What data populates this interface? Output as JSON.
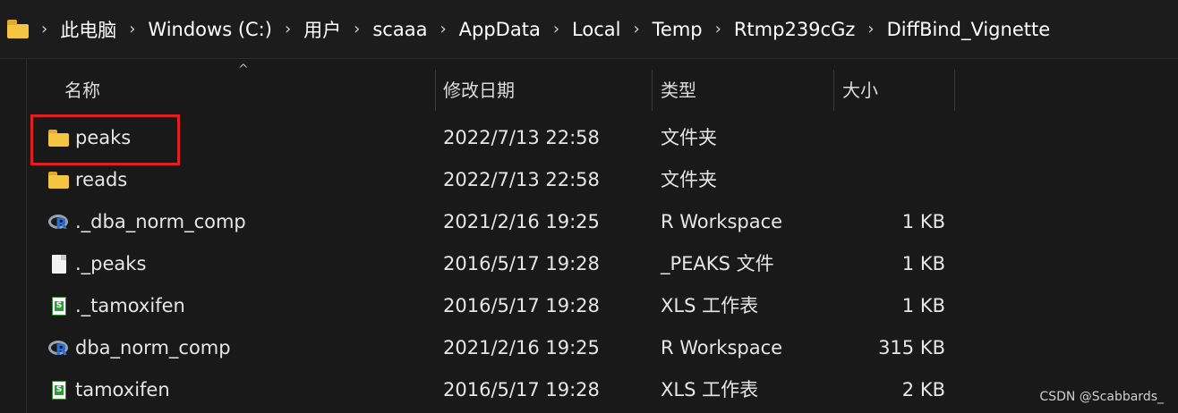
{
  "address_bar": {
    "crumbs": [
      "此电脑",
      "Windows (C:)",
      "用户",
      "scaaa",
      "AppData",
      "Local",
      "Temp",
      "Rtmp239cGz",
      "DiffBind_Vignette"
    ],
    "separator": "›"
  },
  "columns": {
    "name": "名称",
    "date": "修改日期",
    "type": "类型",
    "size": "大小",
    "sort_indicator": "^"
  },
  "files": [
    {
      "name": "peaks",
      "date": "2022/7/13 22:58",
      "type": "文件夹",
      "size": "",
      "icon": "folder-icon"
    },
    {
      "name": "reads",
      "date": "2022/7/13 22:58",
      "type": "文件夹",
      "size": "",
      "icon": "folder-icon"
    },
    {
      "name": "._dba_norm_comp",
      "date": "2021/2/16 19:25",
      "type": "R Workspace",
      "size": "1 KB",
      "icon": "r-workspace-icon"
    },
    {
      "name": "._peaks",
      "date": "2016/5/17 19:28",
      "type": "_PEAKS 文件",
      "size": "1 KB",
      "icon": "file-icon"
    },
    {
      "name": "._tamoxifen",
      "date": "2016/5/17 19:28",
      "type": "XLS 工作表",
      "size": "1 KB",
      "icon": "spreadsheet-icon"
    },
    {
      "name": "dba_norm_comp",
      "date": "2021/2/16 19:25",
      "type": "R Workspace",
      "size": "315 KB",
      "icon": "r-workspace-icon"
    },
    {
      "name": "tamoxifen",
      "date": "2016/5/17 19:28",
      "type": "XLS 工作表",
      "size": "2 KB",
      "icon": "spreadsheet-icon"
    }
  ],
  "watermark": "CSDN @Scabbards_",
  "colors": {
    "highlight": "#e02020",
    "folder": "#f4c542",
    "background": "#191919"
  }
}
